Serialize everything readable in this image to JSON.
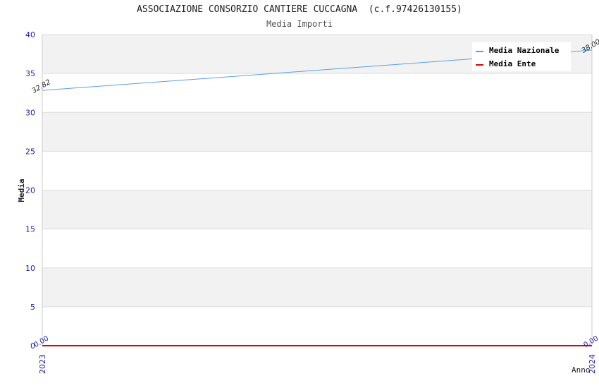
{
  "chart_data": {
    "type": "line",
    "title": "ASSOCIAZIONE CONSORZIO CANTIERE CUCCAGNA  (c.f.97426130155)",
    "subtitle": "Media Importi",
    "xlabel": "Anno",
    "ylabel": "Media",
    "x": [
      "2023",
      "2024"
    ],
    "ylim": [
      0,
      40
    ],
    "yticks": [
      0,
      5,
      10,
      15,
      20,
      25,
      30,
      35,
      40
    ],
    "grid": true,
    "legend_position": "top-right",
    "series": [
      {
        "name": "Media Nazionale",
        "color": "#5aa0e6",
        "values": [
          32.82,
          38.0
        ],
        "labels": [
          "32.82",
          "38.00"
        ]
      },
      {
        "name": "Media Ente",
        "color": "#dd0000",
        "values": [
          0.0,
          0.0
        ],
        "labels": [
          "0.00",
          "0.00"
        ]
      }
    ]
  }
}
